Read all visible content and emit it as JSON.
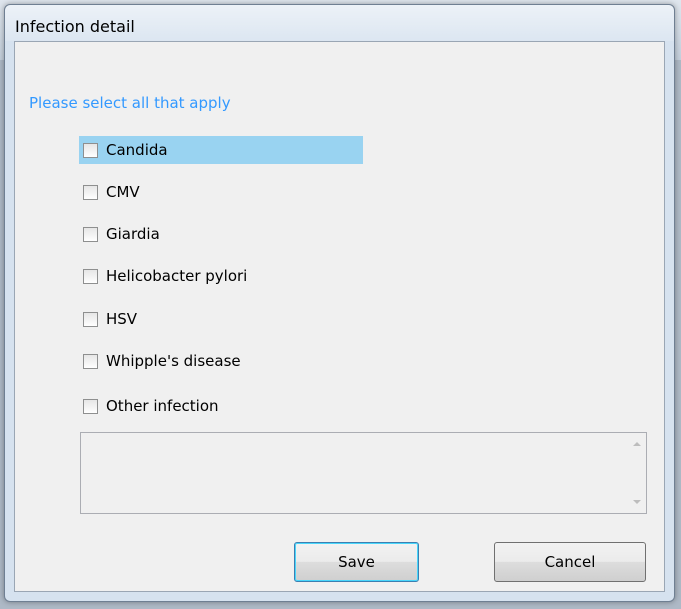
{
  "dialog": {
    "title": "Infection detail",
    "instruction": "Please select all that apply",
    "options": [
      {
        "label": "Candida",
        "checked": false,
        "selected": true
      },
      {
        "label": "CMV",
        "checked": false,
        "selected": false
      },
      {
        "label": "Giardia",
        "checked": false,
        "selected": false
      },
      {
        "label": "Helicobacter pylori",
        "checked": false,
        "selected": false
      },
      {
        "label": "HSV",
        "checked": false,
        "selected": false
      },
      {
        "label": "Whipple's disease",
        "checked": false,
        "selected": false
      },
      {
        "label": "Other infection",
        "checked": false,
        "selected": false
      }
    ],
    "other_text": "",
    "save_label": "Save",
    "cancel_label": "Cancel"
  },
  "colors": {
    "instruction": "#3399ff",
    "selection": "#99d3f1"
  }
}
